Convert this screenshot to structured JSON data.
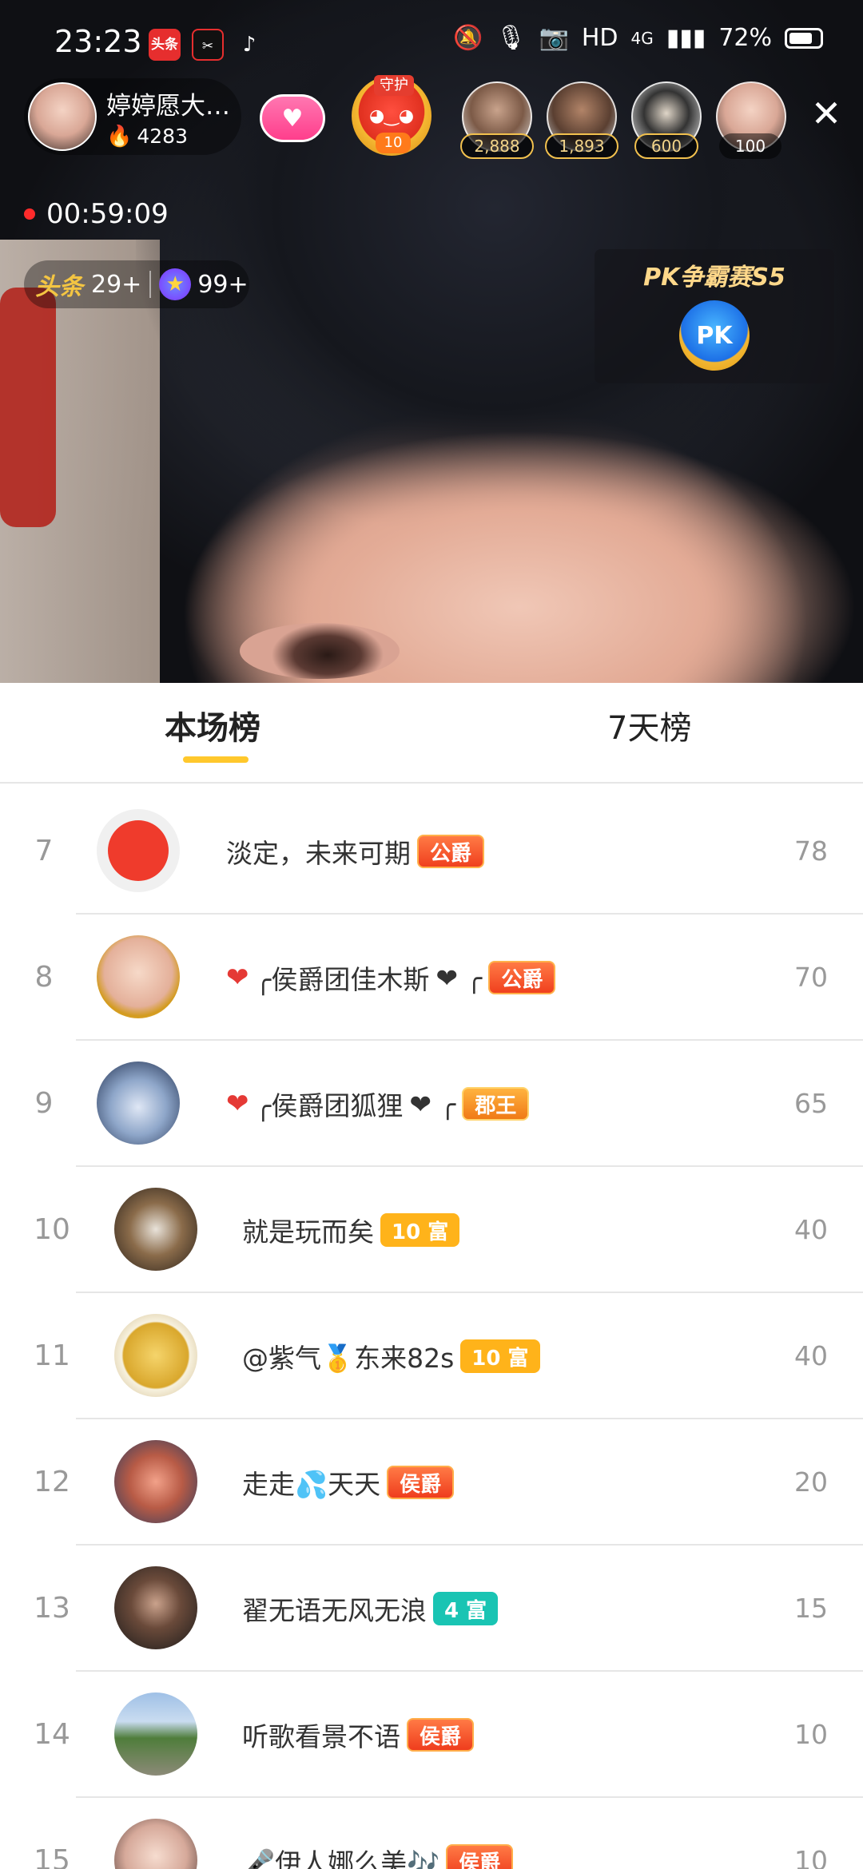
{
  "status_bar": {
    "time": "23:23",
    "app1": "头条",
    "network": "HD",
    "signal": "4G",
    "battery": "72%"
  },
  "host": {
    "name": "婷婷愿大…",
    "heat": "4283"
  },
  "guard": {
    "title": "守护",
    "level": "10"
  },
  "top_viewers": [
    {
      "count": "2,888"
    },
    {
      "count": "1,893"
    },
    {
      "count": "600"
    },
    {
      "count": "100"
    }
  ],
  "live": {
    "duration": "00:59:09"
  },
  "ranking_pill": {
    "toutiao_label": "头条",
    "toutiao_count": "29+",
    "star_count": "99+"
  },
  "pk_card": {
    "title": "PK争霸赛S5",
    "badge": "PK"
  },
  "tabs": [
    {
      "label": "本场榜",
      "active": true
    },
    {
      "label": "7天榜",
      "active": false
    }
  ],
  "rows": [
    {
      "rank": "7",
      "name": "淡定，未来可期",
      "badge": "公爵",
      "badge_type": "gongjue",
      "score": "78"
    },
    {
      "rank": "8",
      "prefix": "❤",
      "name": "╭侯爵团佳木斯",
      "suffix": "❤ ╭",
      "badge": "公爵",
      "badge_type": "gongjue",
      "score": "70"
    },
    {
      "rank": "9",
      "prefix": "❤",
      "name": "╭侯爵团狐狸",
      "suffix": "❤ ╭",
      "badge": "郡王",
      "badge_type": "junwang",
      "score": "65"
    },
    {
      "rank": "10",
      "name": "就是玩而矣",
      "badge": "10 富",
      "badge_type": "fu",
      "score": "40"
    },
    {
      "rank": "11",
      "name": "@紫气🥇东来82s",
      "badge": "10 富",
      "badge_type": "fu",
      "score": "40"
    },
    {
      "rank": "12",
      "name": "走走💦天天",
      "badge": "侯爵",
      "badge_type": "houjue",
      "score": "20"
    },
    {
      "rank": "13",
      "name": "翟无语无风无浪",
      "badge": "4 富",
      "badge_type": "fu4",
      "score": "15"
    },
    {
      "rank": "14",
      "name": "听歌看景不语",
      "badge": "侯爵",
      "badge_type": "houjue",
      "score": "10"
    },
    {
      "rank": "15",
      "name": "🎤伊人娜么美🎶",
      "badge": "侯爵",
      "badge_type": "houjue",
      "score": "10"
    }
  ],
  "colors": {
    "accent_yellow": "#ffc82c",
    "rank_gray": "#999999"
  },
  "icons": {
    "close": "close-icon",
    "mic": "microphone-icon",
    "camera": "camera-icon",
    "mute": "bell-off-icon"
  }
}
